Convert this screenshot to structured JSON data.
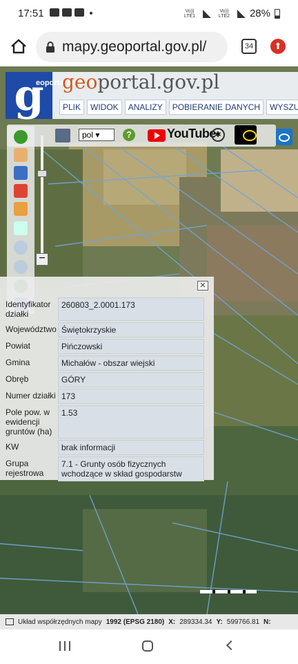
{
  "status": {
    "time": "17:51",
    "sim1": "Vo)) LTE1",
    "sim2": "Vo)) LTE2",
    "battery": "28%"
  },
  "browser": {
    "url": "mapy.geoportal.gov.pl/",
    "tab_count": "34"
  },
  "app": {
    "logo_letter": "g",
    "krajowy": "eoportal krajowy",
    "brand_prefix": "geo",
    "brand_rest": "portal.gov.pl",
    "menu": [
      "PLIK",
      "WIDOK",
      "ANALIZY",
      "POBIERANIE DANYCH",
      "WYSZUKIWAN"
    ],
    "lang_select": "pol",
    "youtube": "YouTube"
  },
  "parcel": {
    "rows": [
      {
        "key": "Identyfikator działki",
        "value": "260803_2.0001.173"
      },
      {
        "key": "Województwo",
        "value": "Świętokrzyskie"
      },
      {
        "key": "Powiat",
        "value": "Pińczowski"
      },
      {
        "key": "Gmina",
        "value": "Michałów - obszar wiejski"
      },
      {
        "key": "Obręb",
        "value": "GÓRY"
      },
      {
        "key": "Numer działki",
        "value": "173"
      },
      {
        "key": "Pole pow. w ewidencji gruntów (ha)",
        "value": "1.53"
      },
      {
        "key": "KW",
        "value": "brak informacji"
      },
      {
        "key": "Grupa rejestrowa",
        "value": "7.1 - Grunty osób fizycznych wchodzące w skład gospodarstw"
      }
    ]
  },
  "coords": {
    "label": "Układ współrzędnych mapy",
    "system": "1992 (EPSG 2180)",
    "x_label": "X:",
    "x": "289334.34",
    "y_label": "Y:",
    "y": "599766.81",
    "n_label": "N:"
  }
}
